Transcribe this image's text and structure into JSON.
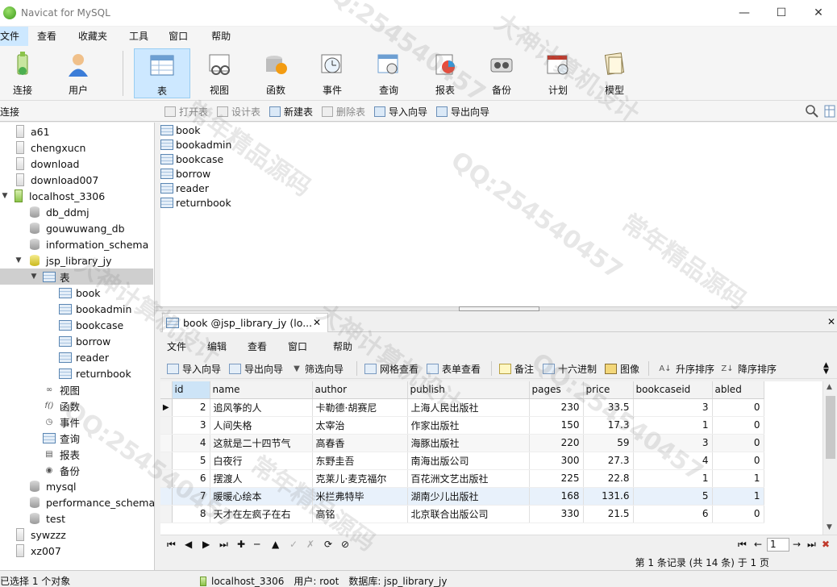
{
  "window": {
    "title": "Navicat for MySQL",
    "minimize": "—",
    "maximize": "☐",
    "close": "✕"
  },
  "menu": [
    "文件",
    "查看",
    "收藏夹",
    "工具",
    "窗口",
    "帮助"
  ],
  "toolbar": {
    "connect": "连接",
    "user": "用户",
    "table": "表",
    "view": "视图",
    "function": "函数",
    "event": "事件",
    "query": "查询",
    "report": "报表",
    "backup": "备份",
    "schedule": "计划",
    "model": "模型"
  },
  "objbar": {
    "connection_label": "连接",
    "open_table": "打开表",
    "design_table": "设计表",
    "new_table": "新建表",
    "delete_table": "删除表",
    "import_wizard": "导入向导",
    "export_wizard": "导出向导"
  },
  "sidebar": {
    "connections_top": [
      "a61",
      "chengxucn",
      "download",
      "download007"
    ],
    "open_connection": "localhost_3306",
    "databases_top": [
      "db_ddmj",
      "gouwuwang_db",
      "information_schema"
    ],
    "open_database": "jsp_library_jy",
    "tables_node": "表",
    "tables": [
      "book",
      "bookadmin",
      "bookcase",
      "borrow",
      "reader",
      "returnbook"
    ],
    "other_nodes": [
      "视图",
      "函数",
      "事件",
      "查询",
      "报表",
      "备份"
    ],
    "databases_bottom": [
      "mysql",
      "performance_schema",
      "test"
    ],
    "connections_bottom": [
      "sywzzz",
      "xz007"
    ]
  },
  "object_list": [
    "book",
    "bookadmin",
    "bookcase",
    "borrow",
    "reader",
    "returnbook"
  ],
  "tab": {
    "label": "book @jsp_library_jy (lo...",
    "close": "✕"
  },
  "inner_menu": [
    "文件",
    "编辑",
    "查看",
    "窗口",
    "帮助"
  ],
  "inner_toolbar": {
    "import_wizard": "导入向导",
    "export_wizard": "导出向导",
    "filter_wizard": "筛选向导",
    "grid_view": "网格查看",
    "form_view": "表单查看",
    "memo": "备注",
    "hex": "十六进制",
    "image": "图像",
    "sort_asc": "升序排序",
    "sort_desc": "降序排序"
  },
  "grid": {
    "columns": [
      "id",
      "name",
      "author",
      "publish",
      "pages",
      "price",
      "bookcaseid",
      "abled"
    ],
    "rows": [
      [
        "2",
        "追风筝的人",
        "卡勒德·胡赛尼",
        "上海人民出版社",
        "230",
        "33.5",
        "3",
        "0"
      ],
      [
        "3",
        "人间失格",
        "太宰治",
        "作家出版社",
        "150",
        "17.3",
        "1",
        "0"
      ],
      [
        "4",
        "这就是二十四节气",
        "高春香",
        "海豚出版社",
        "220",
        "59",
        "3",
        "0"
      ],
      [
        "5",
        "白夜行",
        "东野圭吾",
        "南海出版公司",
        "300",
        "27.3",
        "4",
        "0"
      ],
      [
        "6",
        "摆渡人",
        "克莱儿·麦克福尔",
        "百花洲文艺出版社",
        "225",
        "22.8",
        "1",
        "1"
      ],
      [
        "7",
        "暖暖心绘本",
        "米拦弗特毕",
        "湖南少儿出版社",
        "168",
        "131.6",
        "5",
        "1"
      ],
      [
        "8",
        "天才在左疯子在右",
        "高铭",
        "北京联合出版公司",
        "330",
        "21.5",
        "6",
        "0"
      ]
    ]
  },
  "navbar": {
    "page": "1",
    "record_info": "第 1 条记录 (共 14 条) 于 1 页"
  },
  "status": {
    "selection": "已选择 1 个对象",
    "connection": "localhost_3306",
    "user": "用户: root",
    "database": "数据库: jsp_library_jy"
  },
  "watermarks": [
    "大神计算机设计",
    "QQ:254540457",
    "常年精品源码"
  ]
}
